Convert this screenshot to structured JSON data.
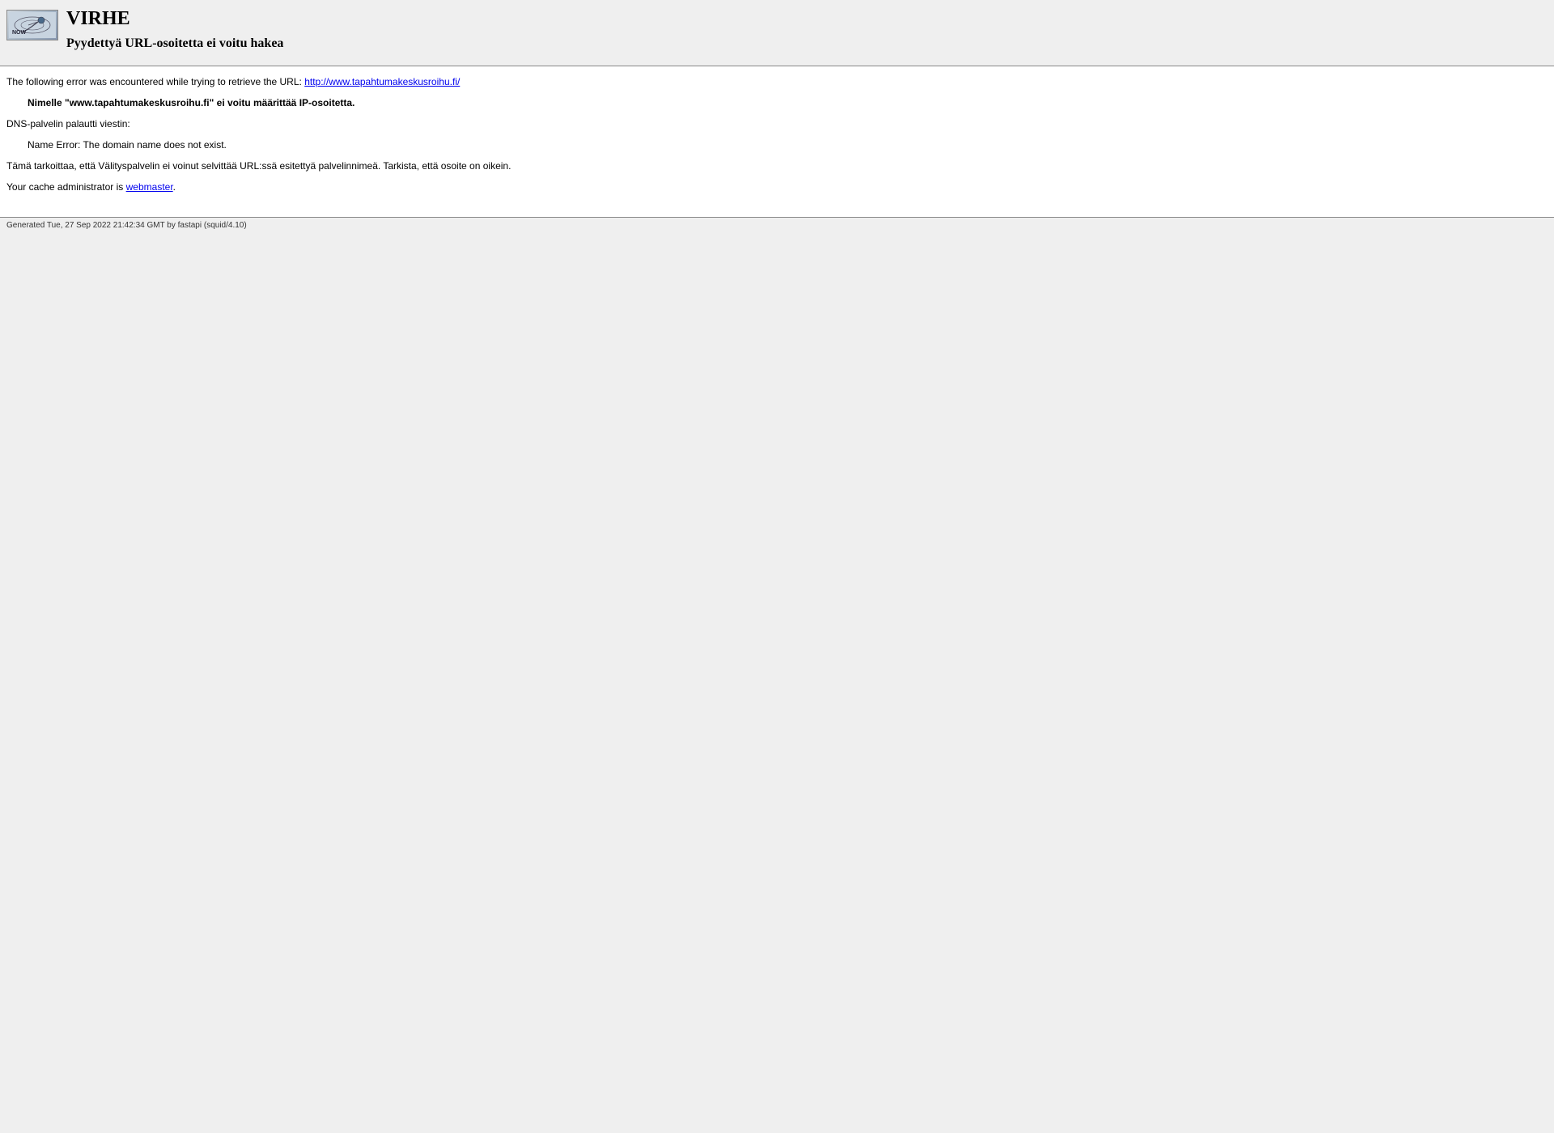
{
  "header": {
    "title": "VIRHE",
    "subtitle": "Pyydettyä URL-osoitetta ei voitu hakea"
  },
  "content": {
    "error_prefix": "The following error was encountered while trying to retrieve the URL: ",
    "error_url": "http://www.tapahtumakeskusroihu.fi/",
    "hostname_error": "Nimelle \"www.tapahtumakeskusroihu.fi\" ei voitu määrittää IP-osoitetta.",
    "dns_returned_label": "DNS-palvelin palautti viestin:",
    "dns_message": "Name Error: The domain name does not exist.",
    "explanation": "Tämä tarkoittaa, että Välityspalvelin ei voinut selvittää URL:ssä esitettyä palvelinnimeä. Tarkista, että osoite on oikein.",
    "admin_prefix": "Your cache administrator is ",
    "admin_link": "webmaster",
    "admin_suffix": "."
  },
  "footer": {
    "generated": "Generated Tue, 27 Sep 2022 21:42:34 GMT by fastapi (squid/4.10)"
  }
}
